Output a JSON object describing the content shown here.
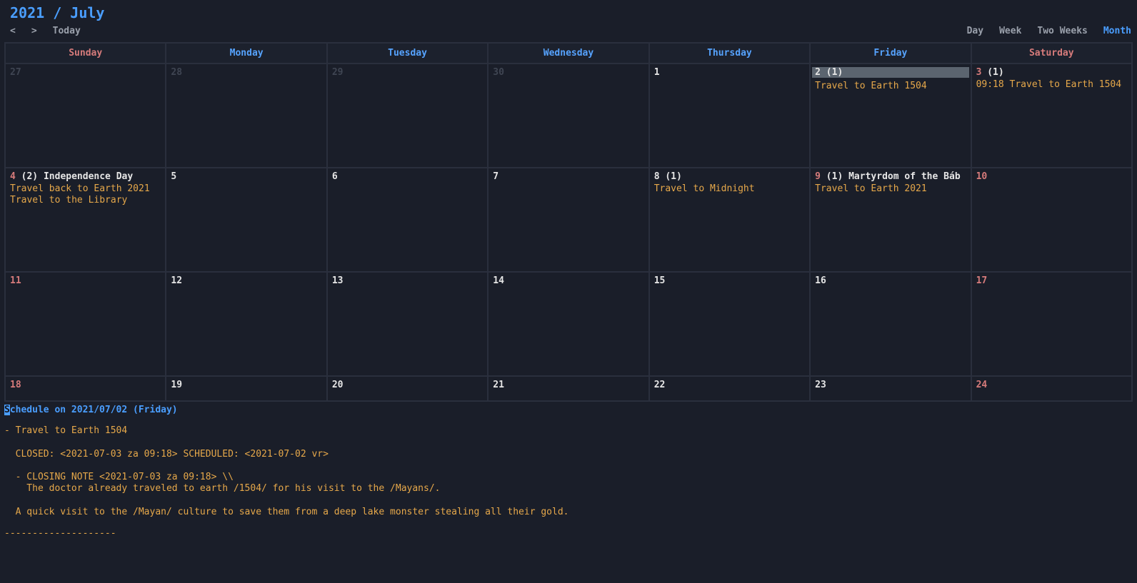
{
  "header": {
    "title": "2021 / July",
    "prev": "<",
    "next": ">",
    "today": "Today"
  },
  "views": {
    "day": "Day",
    "week": "Week",
    "two_weeks": "Two Weeks",
    "month": "Month"
  },
  "dow": [
    "Sunday",
    "Monday",
    "Tuesday",
    "Wednesday",
    "Thursday",
    "Friday",
    "Saturday"
  ],
  "weeks": [
    {
      "days": [
        {
          "num": "27",
          "muted": true
        },
        {
          "num": "28",
          "muted": true
        },
        {
          "num": "29",
          "muted": true
        },
        {
          "num": "30",
          "muted": true
        },
        {
          "num": "1"
        },
        {
          "num": "2",
          "count": "(1)",
          "selected": true,
          "events": [
            "Travel to Earth 1504"
          ]
        },
        {
          "num": "3",
          "weekend": true,
          "count": "(1)",
          "events": [
            "09:18 Travel to Earth 1504"
          ]
        }
      ]
    },
    {
      "days": [
        {
          "num": "4",
          "weekend": true,
          "count": "(2)",
          "holiday": "Independence Day",
          "events": [
            "Travel back to Earth 2021",
            "Travel to the Library"
          ]
        },
        {
          "num": "5"
        },
        {
          "num": "6"
        },
        {
          "num": "7"
        },
        {
          "num": "8",
          "count": "(1)",
          "events": [
            "Travel to Midnight"
          ]
        },
        {
          "num": "9",
          "weekend": true,
          "count": "(1)",
          "holiday": "Martyrdom of the Báb",
          "events": [
            "Travel to Earth 2021"
          ]
        },
        {
          "num": "10",
          "weekend": true
        }
      ]
    },
    {
      "days": [
        {
          "num": "11",
          "weekend": true
        },
        {
          "num": "12"
        },
        {
          "num": "13"
        },
        {
          "num": "14"
        },
        {
          "num": "15"
        },
        {
          "num": "16"
        },
        {
          "num": "17",
          "weekend": true
        }
      ]
    },
    {
      "days": [
        {
          "num": "18",
          "weekend": true
        },
        {
          "num": "19"
        },
        {
          "num": "20"
        },
        {
          "num": "21"
        },
        {
          "num": "22"
        },
        {
          "num": "23"
        },
        {
          "num": "24",
          "weekend": true
        }
      ]
    }
  ],
  "detail": {
    "title_prefix": "S",
    "title_rest": "chedule on 2021/07/02 (Friday)",
    "body": "- Travel to Earth 1504\n\n  CLOSED: <2021-07-03 za 09:18> SCHEDULED: <2021-07-02 vr>\n\n  - CLOSING NOTE <2021-07-03 za 09:18> \\\\\n    The doctor already traveled to earth /1504/ for his visit to the /Mayans/.\n\n  A quick visit to the /Mayan/ culture to save them from a deep lake monster stealing all their gold.",
    "rule": "--------------------"
  }
}
